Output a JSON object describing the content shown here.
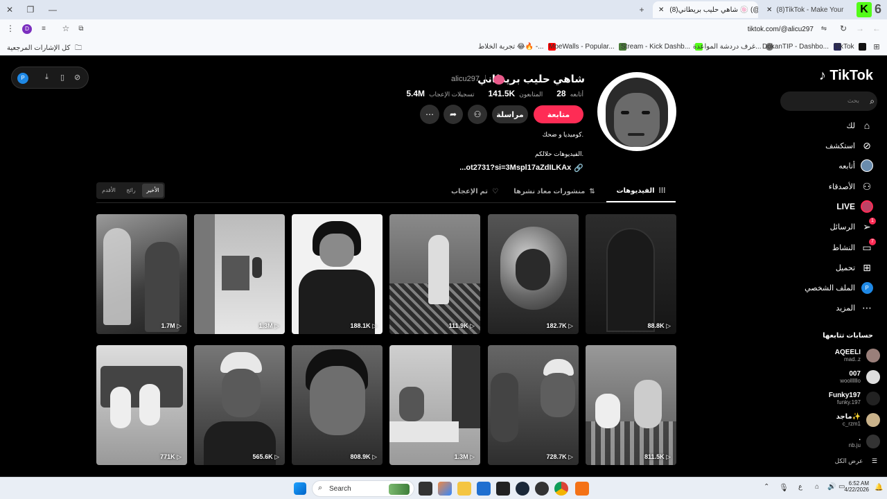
{
  "browser": {
    "tabs": [
      {
        "title": "(8)TikTok - Make Your Day",
        "active": false
      },
      {
        "title": "(8)شاهي حليب بريطاني 🍥 (@",
        "active": true
      }
    ],
    "tab_counter": "6",
    "url": "tiktok.com/@alicu297",
    "profile_initial": "D",
    "bookmarks": [
      {
        "label": "TikTok"
      },
      {
        "label": "DokanTIP - Dashbo..."
      },
      {
        "label": "غرف دردشة المواعدة..."
      },
      {
        "label": "Stream - Kick Dashb..."
      },
      {
        "label": "MoeWalls - Popular..."
      },
      {
        "label": "تجربة الخلاط 😂🔥 -..."
      }
    ],
    "all_bookmarks": "كل الإشارات المرجعية"
  },
  "extension": {
    "initial": "P"
  },
  "sidebar": {
    "logo": "TikTok",
    "search_placeholder": "بحث",
    "items": [
      {
        "label": "لك",
        "icon": "home-icon"
      },
      {
        "label": "استكشف",
        "icon": "compass-icon"
      },
      {
        "label": "أتابعه",
        "icon": "avatar-icon"
      },
      {
        "label": "الأصدقاء",
        "icon": "friends-icon"
      },
      {
        "label": "LIVE",
        "icon": "live-icon"
      },
      {
        "label": "الرسائل",
        "icon": "send-icon",
        "badge": "1"
      },
      {
        "label": "النشاط",
        "icon": "inbox-icon",
        "badge": "7"
      },
      {
        "label": "تحميل",
        "icon": "plus-square-icon"
      },
      {
        "label": "الملف الشخصي",
        "icon": "profile-icon",
        "initial": "P"
      },
      {
        "label": "المزيد",
        "icon": "more-icon"
      }
    ],
    "following_title": "حسابات تتابعها",
    "following": [
      {
        "name": "AQEELI",
        "handle": "mad..z"
      },
      {
        "name": "007",
        "handle": "woollllllo"
      },
      {
        "name": "Funky197",
        "handle": "funky.197"
      },
      {
        "name": "ماجد✨",
        "handle": "c_rzm1"
      },
      {
        "name": ".",
        "handle": "nb.ju"
      }
    ],
    "see_all": "عرض الكل"
  },
  "profile": {
    "name": "شاهي حليب بريطاني",
    "username": "alicu297",
    "following_count": "28",
    "following_label": "أتابعه",
    "followers_count": "141.5K",
    "followers_label": "المتابعون",
    "likes_count": "5.4M",
    "likes_label": "تسجيلات الإعجاب",
    "follow_button": "متابعة",
    "message_button": "مراسلة",
    "bio_line1": "كوميديا و ضحك.",
    "bio_line2": "الفيديوهات حلالكم.",
    "link": "...ot2731?si=3Mspl17aZdILKAx"
  },
  "tabs": [
    {
      "label": "الفيديوهات",
      "active": true
    },
    {
      "label": "منشورات معاد نشرها",
      "active": false
    },
    {
      "label": "تم الإعجاب",
      "active": false
    }
  ],
  "sort": [
    {
      "label": "الأخير",
      "active": true
    },
    {
      "label": "رائج",
      "active": false
    },
    {
      "label": "الأقدم",
      "active": false
    }
  ],
  "videos": [
    {
      "views": "1.7M"
    },
    {
      "views": "1.3M"
    },
    {
      "views": "188.1K"
    },
    {
      "views": "111.9K"
    },
    {
      "views": "182.7K"
    },
    {
      "views": "88.8K"
    },
    {
      "views": "771K"
    },
    {
      "views": "565.6K"
    },
    {
      "views": "808.9K"
    },
    {
      "views": "1.3M"
    },
    {
      "views": "728.7K"
    },
    {
      "views": "811.5K"
    }
  ],
  "taskbar": {
    "search": "Search",
    "time": "6:52 AM",
    "date": "4/22/2026",
    "lang": "ع"
  },
  "colors": {
    "accent": "#fe2c55",
    "background": "#000000"
  }
}
